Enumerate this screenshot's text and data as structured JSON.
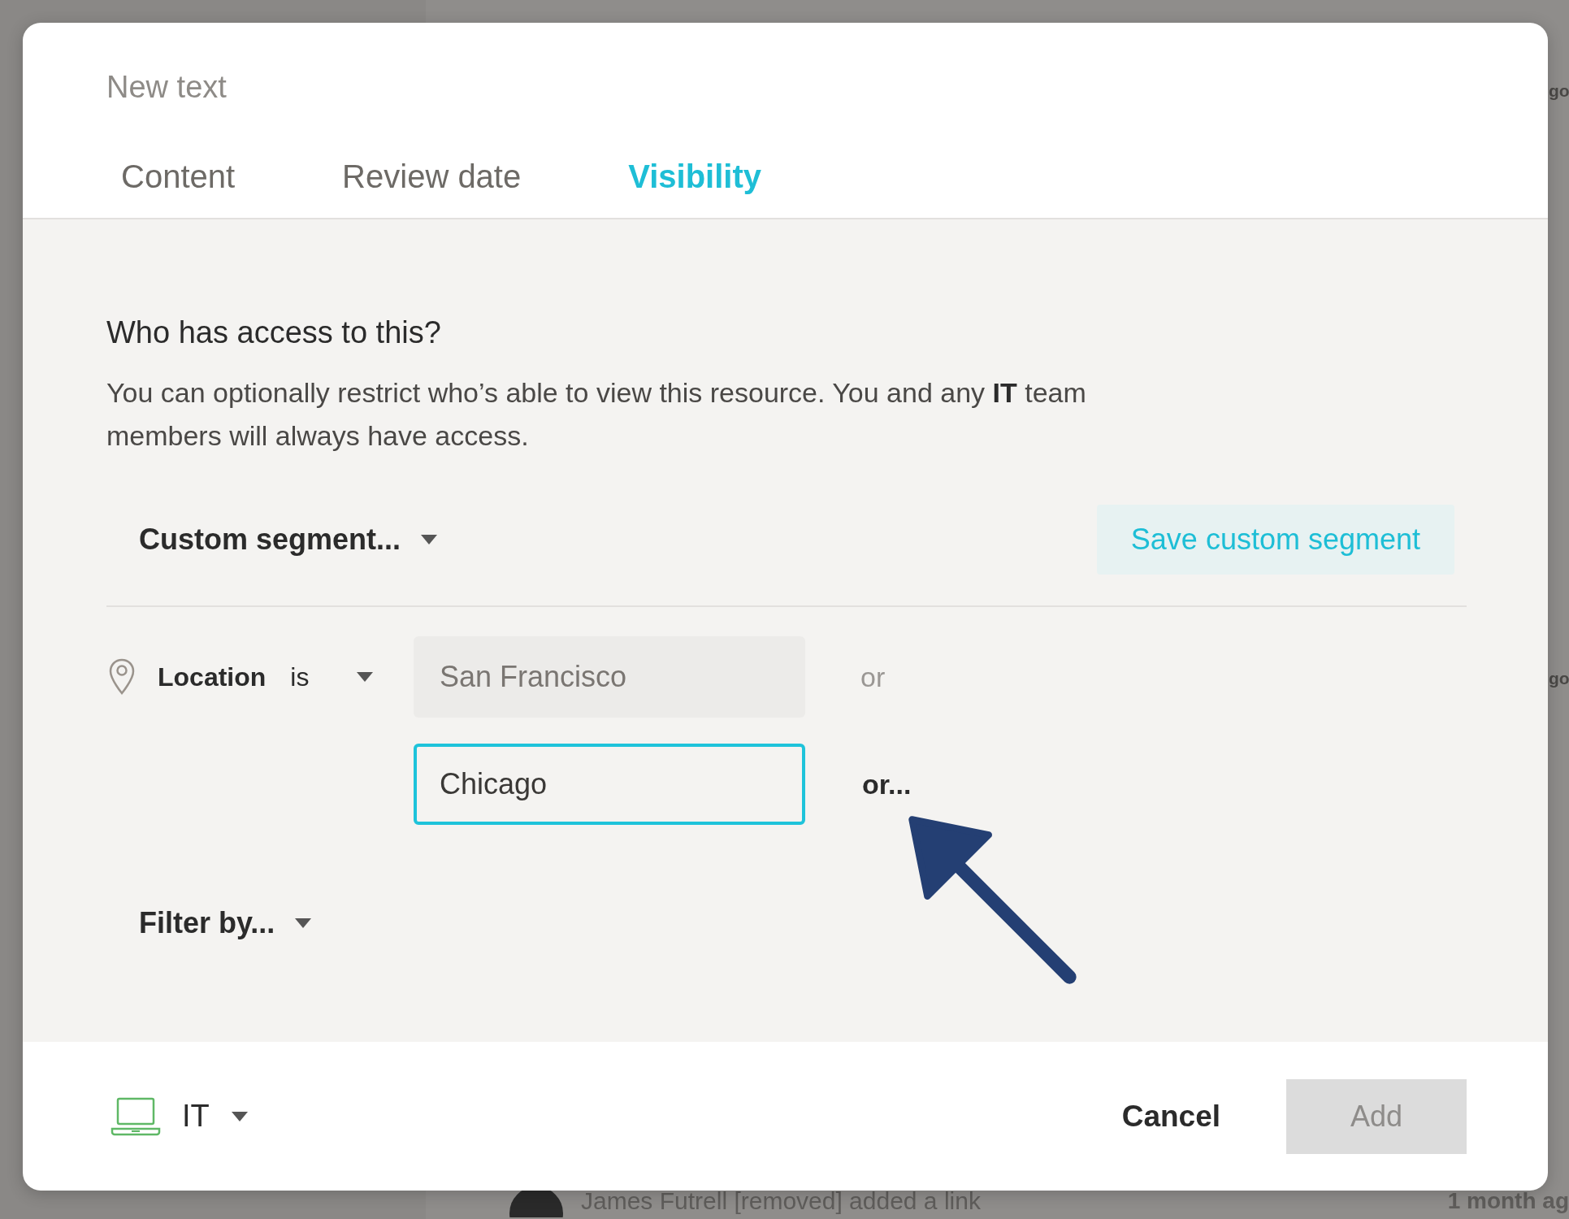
{
  "background": {
    "edge_texts": [
      "go",
      "go"
    ],
    "activity": {
      "text": "James Futrell [removed] added a link",
      "time": "1 month ag"
    }
  },
  "dialog": {
    "title": "New text",
    "tabs": [
      {
        "label": "Content",
        "selected": false
      },
      {
        "label": "Review date",
        "selected": false
      },
      {
        "label": "Visibility",
        "selected": true
      }
    ],
    "heading": "Who has access to this?",
    "description": "You can optionally restrict who’s able to view this resource. You and any **IT** team members will always have access.",
    "segment_dropdown": "Custom segment...",
    "save_button": "Save custom segment",
    "condition": {
      "field": "Location",
      "operator": "is",
      "values": [
        {
          "value": "San Francisco",
          "focused": false,
          "connector": "or"
        },
        {
          "value": "Chicago",
          "focused": true,
          "connector": "or..."
        }
      ]
    },
    "filter_dropdown": "Filter by...",
    "footer": {
      "team": "IT",
      "cancel": "Cancel",
      "add": {
        "label": "Add",
        "disabled": true
      }
    }
  }
}
